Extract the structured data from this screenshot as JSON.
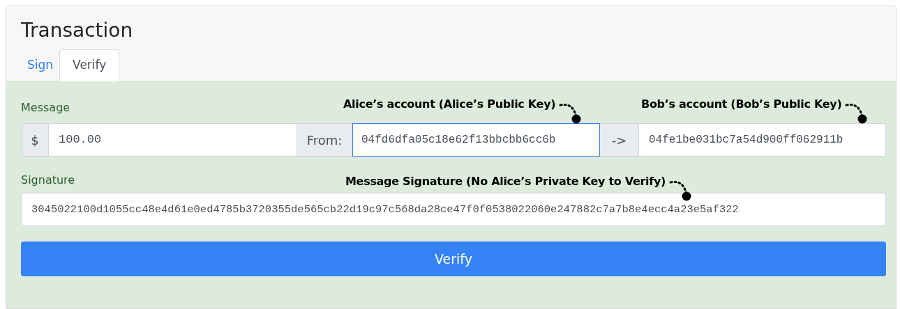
{
  "card": {
    "title": "Transaction"
  },
  "tabs": [
    {
      "label": "Sign",
      "selected": false
    },
    {
      "label": "Verify",
      "selected": true
    }
  ],
  "message": {
    "label": "Message",
    "currency": "$",
    "amount": "100.00",
    "from_label": "From:",
    "from_value": "04fd6dfa05c18e62f13bbcbb6cc6b",
    "from_focused": true,
    "arrow": "->",
    "to_value": "04fe1be031bc7a54d900ff062911b"
  },
  "signature": {
    "label": "Signature",
    "value": "3045022100d1055cc48e4d61e0ed4785b3720355de565cb22d19c97c568da28ce47f0f0538022060e247882c7a7b8e4ecc4a23e5af322"
  },
  "annotations": [
    {
      "text": "Alice’s account (Alice’s Public Key)"
    },
    {
      "text": "Bob’s account (Bob’s Public Key)"
    },
    {
      "text": "Message Signature (No Alice’s Private Key to Verify)"
    }
  ],
  "verify_button": "Verify"
}
